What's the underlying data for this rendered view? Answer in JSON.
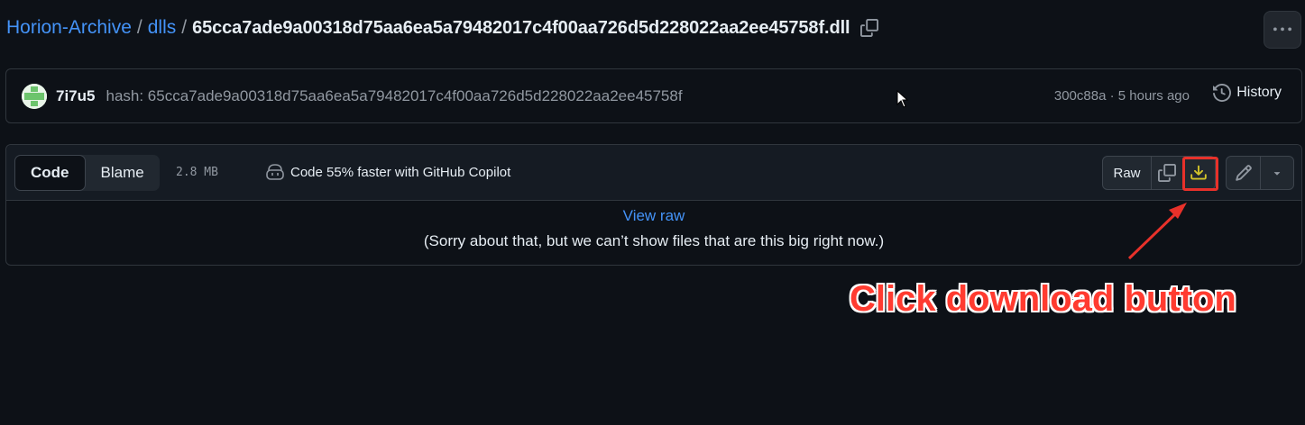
{
  "breadcrumb": {
    "repo": "Horion-Archive",
    "sep1": "/",
    "folder": "dlls",
    "sep2": "/",
    "file": "65cca7ade9a00318d75aa6ea5a79482017c4f00aa726d5d228022aa2ee45758f.dll"
  },
  "commit": {
    "author": "7i7u5",
    "message": "hash: 65cca7ade9a00318d75aa6ea5a79482017c4f00aa726d5d228022aa2ee45758f",
    "meta": "300c88a · 5 hours ago",
    "history_label": "History"
  },
  "file_header": {
    "code_tab": "Code",
    "blame_tab": "Blame",
    "size": "2.8 MB",
    "copilot_text": "Code 55% faster with GitHub Copilot",
    "raw_label": "Raw"
  },
  "file_body": {
    "view_raw": "View raw",
    "sorry": "(Sorry about that, but we can’t show files that are this big right now.)"
  },
  "annotation": {
    "text": "Click download button",
    "color": "#ff3b30"
  },
  "colors": {
    "bg": "#0d1117",
    "link": "#4493f8",
    "border": "#30363d",
    "download_icon": "#d4c52a"
  }
}
